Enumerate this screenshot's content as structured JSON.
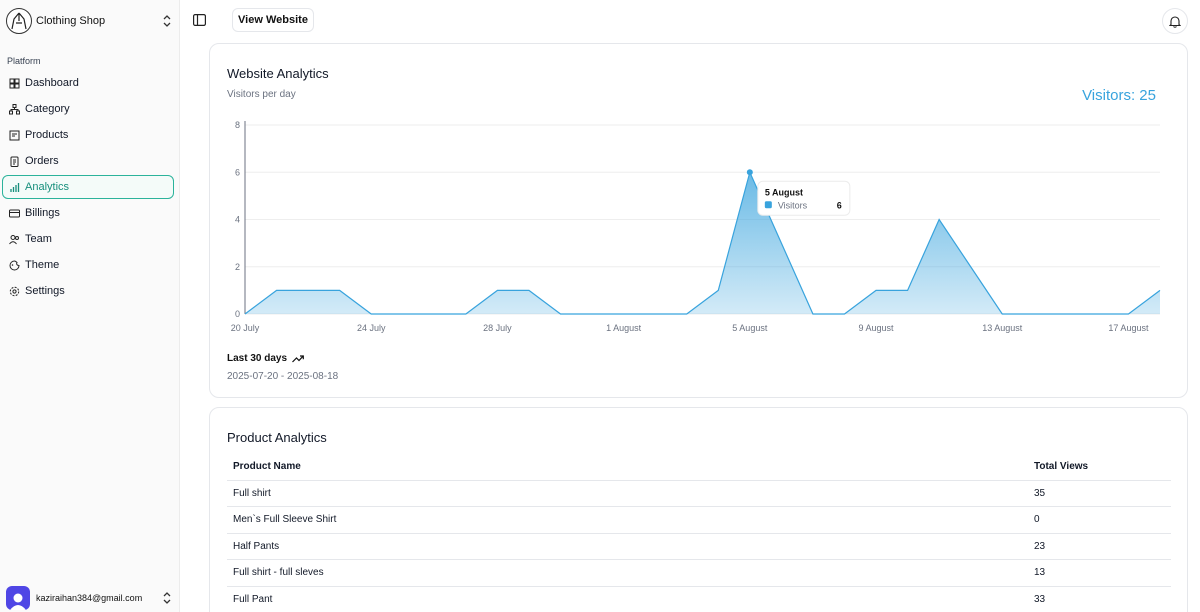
{
  "shop": {
    "name": "Clothing Shop"
  },
  "sidebar": {
    "section_label": "Platform",
    "items": [
      {
        "label": "Dashboard",
        "icon": "dashboard-icon"
      },
      {
        "label": "Category",
        "icon": "category-icon"
      },
      {
        "label": "Products",
        "icon": "products-icon"
      },
      {
        "label": "Orders",
        "icon": "orders-icon"
      },
      {
        "label": "Analytics",
        "icon": "analytics-icon",
        "active": true
      },
      {
        "label": "Billings",
        "icon": "billing-icon"
      },
      {
        "label": "Team",
        "icon": "team-icon"
      },
      {
        "label": "Theme",
        "icon": "theme-icon"
      },
      {
        "label": "Settings",
        "icon": "settings-icon"
      }
    ]
  },
  "user": {
    "email": "kaziraihan384@gmail.com"
  },
  "topbar": {
    "view_website_label": "View Website"
  },
  "website_analytics": {
    "title": "Website Analytics",
    "subtitle": "Visitors per day",
    "visitors_label": "Visitors: 25",
    "trend_label": "Last 30 days",
    "date_range": "2025-07-20 - 2025-08-18",
    "tooltip": {
      "date": "5 August",
      "series": "Visitors",
      "value": "6"
    }
  },
  "chart_data": {
    "type": "area",
    "x": [
      "20 July",
      "21 July",
      "22 July",
      "23 July",
      "24 July",
      "25 July",
      "26 July",
      "27 July",
      "28 July",
      "29 July",
      "30 July",
      "31 July",
      "1 August",
      "2 August",
      "3 August",
      "4 August",
      "5 August",
      "6 August",
      "7 August",
      "8 August",
      "9 August",
      "10 August",
      "11 August",
      "12 August",
      "13 August",
      "14 August",
      "15 August",
      "16 August",
      "17 August",
      "18 August"
    ],
    "series": [
      {
        "name": "Visitors",
        "values": [
          0,
          1,
          1,
          1,
          0,
          0,
          0,
          0,
          1,
          1,
          0,
          0,
          0,
          0,
          0,
          1,
          6,
          3,
          0,
          0,
          1,
          1,
          4,
          2,
          0,
          0,
          0,
          0,
          0,
          1
        ]
      }
    ],
    "x_tick_labels": [
      "20 July",
      "24 July",
      "28 July",
      "1 August",
      "5 August",
      "9 August",
      "13 August",
      "17 August"
    ],
    "y_ticks": [
      "0",
      "2",
      "4",
      "6",
      "8"
    ],
    "ylim": [
      0,
      8
    ],
    "grid": "horizontal",
    "color": "#38a3dd"
  },
  "product_analytics": {
    "title": "Product Analytics",
    "columns": [
      "Product Name",
      "Total Views"
    ],
    "rows": [
      [
        "Full shirt",
        "35"
      ],
      [
        "Men`s Full Sleeve Shirt",
        "0"
      ],
      [
        "Half Pants",
        "23"
      ],
      [
        "Full shirt - full sleves",
        "13"
      ],
      [
        "Full Pant",
        "33"
      ]
    ]
  }
}
